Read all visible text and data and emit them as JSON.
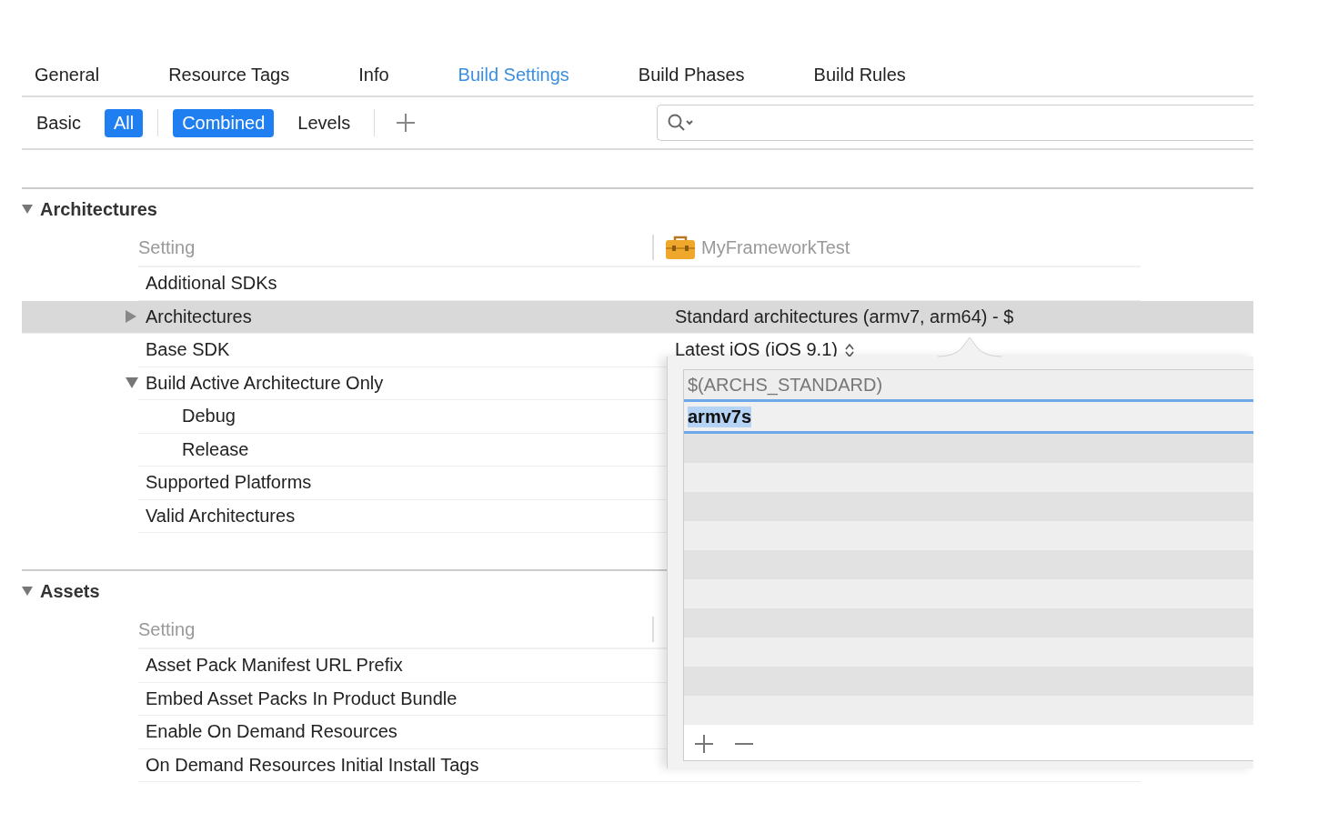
{
  "tabs": [
    {
      "label": "General",
      "selected": false
    },
    {
      "label": "Resource Tags",
      "selected": false
    },
    {
      "label": "Info",
      "selected": false
    },
    {
      "label": "Build Settings",
      "selected": true
    },
    {
      "label": "Build Phases",
      "selected": false
    },
    {
      "label": "Build Rules",
      "selected": false
    }
  ],
  "scope_filters": [
    {
      "label": "Basic",
      "selected": false
    },
    {
      "label": "All",
      "selected": true
    }
  ],
  "view_filters": [
    {
      "label": "Combined",
      "selected": true
    },
    {
      "label": "Levels",
      "selected": false
    }
  ],
  "sections": [
    {
      "title": "Architectures",
      "expanded": true,
      "column_header": "Setting",
      "target": "MyFrameworkTest",
      "rows": [
        {
          "name": "Additional SDKs",
          "selected": false
        },
        {
          "name": "Architectures",
          "selected": true,
          "expanded": false,
          "value": "Standard architectures (armv7, arm64)  -  $"
        },
        {
          "name": "Base SDK",
          "selected": false,
          "value": "Latest iOS (iOS 9.1)",
          "stepper": true
        },
        {
          "name": "Build Active Architecture Only",
          "selected": false,
          "expanded": true,
          "children": [
            {
              "name": "Debug",
              "selected": false
            },
            {
              "name": "Release",
              "selected": false
            }
          ]
        },
        {
          "name": "Supported Platforms",
          "selected": false
        },
        {
          "name": "Valid Architectures",
          "selected": false
        }
      ]
    },
    {
      "title": "Assets",
      "expanded": true,
      "column_header": "Setting",
      "rows": [
        {
          "name": "Asset Pack Manifest URL Prefix",
          "selected": false
        },
        {
          "name": "Embed Asset Packs In Product Bundle",
          "selected": false
        },
        {
          "name": "Enable On Demand Resources",
          "selected": false
        },
        {
          "name": "On Demand Resources Initial Install Tags",
          "selected": false
        }
      ]
    }
  ],
  "popover": {
    "items": [
      {
        "text": "$(ARCHS_STANDARD)",
        "kind": "value"
      },
      {
        "text": "armv7s",
        "kind": "editing"
      }
    ]
  }
}
